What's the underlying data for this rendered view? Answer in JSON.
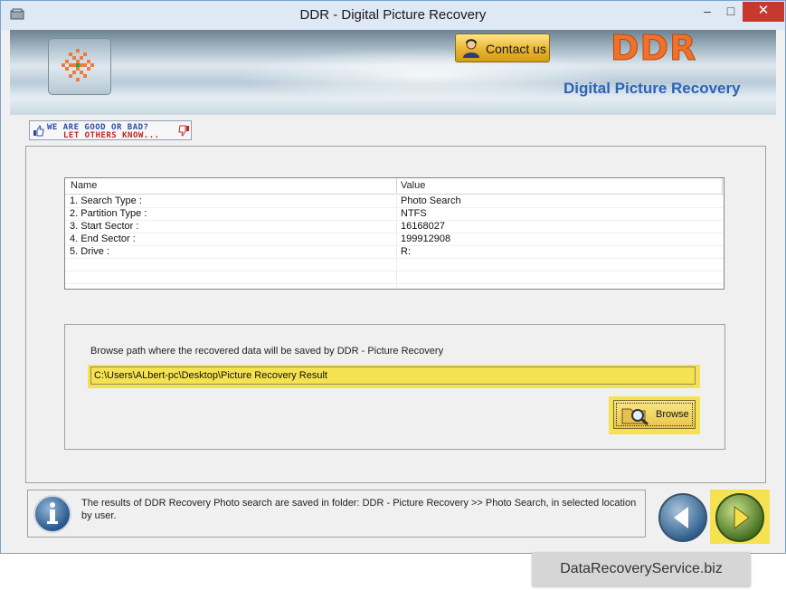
{
  "window": {
    "title": "DDR - Digital Picture Recovery",
    "minimize": "–",
    "maximize": "□",
    "close": "✕"
  },
  "banner": {
    "contact_label": "Contact us",
    "brand": "DDR",
    "subtitle": "Digital Picture Recovery"
  },
  "rating": {
    "line1": "WE ARE GOOD OR BAD?",
    "line2": "LET OTHERS KNOW..."
  },
  "table": {
    "headers": [
      "Name",
      "Value"
    ],
    "rows": [
      {
        "name": "1. Search Type :",
        "value": "Photo Search"
      },
      {
        "name": "2. Partition Type :",
        "value": "NTFS"
      },
      {
        "name": "3. Start Sector :",
        "value": "16168027"
      },
      {
        "name": "4. End Sector :",
        "value": "199912908"
      },
      {
        "name": "5. Drive :",
        "value": "R:"
      }
    ]
  },
  "browse": {
    "label": "Browse path where the recovered data will be saved by DDR - Picture Recovery",
    "path": "C:\\Users\\ALbert-pc\\Desktop\\Picture Recovery Result",
    "button": "Browse"
  },
  "status": {
    "text": "The results of DDR Recovery Photo search are saved in folder: DDR - Picture Recovery  >> Photo Search, in selected location by user."
  },
  "footer": {
    "site": "DataRecoveryService.biz"
  },
  "colors": {
    "highlight": "#f5e252",
    "brand_orange": "#f1712a",
    "subtitle_blue": "#2d62b8",
    "close_red": "#c7392f"
  }
}
